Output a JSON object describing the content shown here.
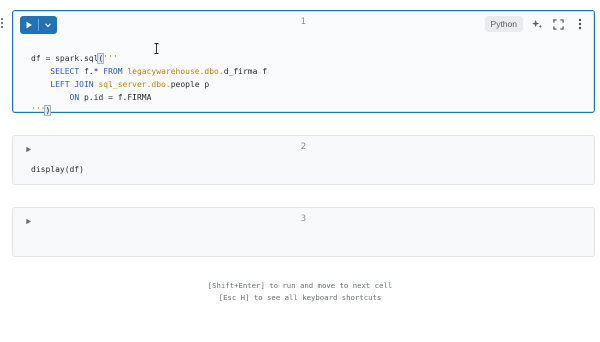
{
  "cells": [
    {
      "number": "1",
      "language_label": "Python",
      "code_lines": {
        "l1_a": "df = spark.sql",
        "l1_b": "(",
        "l1_c": "'''",
        "l2_kw1": "SELECT",
        "l2_id": " f.* ",
        "l2_kw2": "FROM",
        "l2_str": " legacywarehouse.dbo.",
        "l2_id2": "d_firma f",
        "l3_kw1": "LEFT JOIN",
        "l3_str": " sql_server.dbo.",
        "l3_id": "people p",
        "l4_kw": "ON",
        "l4_rest": " p.id = f.FIRMA",
        "l5_a": "'''",
        "l5_b": ")"
      }
    },
    {
      "number": "2",
      "code": "display(df)"
    },
    {
      "number": "3",
      "code": ""
    }
  ],
  "hints": {
    "line1": "[Shift+Enter] to run and move to next cell",
    "line2": "[Esc H] to see all keyboard shortcuts"
  },
  "icons": [
    "play-icon",
    "chevron-down-icon",
    "assistant-sparkle-icon",
    "fullscreen-icon",
    "kebab-menu-icon",
    "drag-handle-icon"
  ]
}
